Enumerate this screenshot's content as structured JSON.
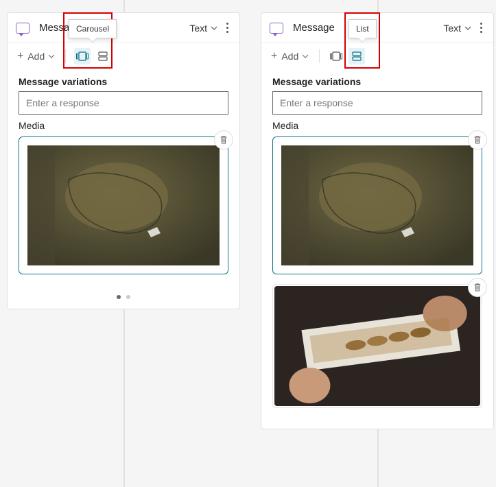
{
  "left": {
    "title": "Message",
    "text_dropdown": "Text",
    "add_label": "Add",
    "tooltip": "Carousel",
    "section_variations": "Message variations",
    "response_placeholder": "Enter a response",
    "media_label": "Media"
  },
  "right": {
    "title": "Message",
    "text_dropdown": "Text",
    "add_label": "Add",
    "tooltip": "List",
    "section_variations": "Message variations",
    "response_placeholder": "Enter a response",
    "media_label": "Media"
  },
  "highlight_color": "#d40000"
}
